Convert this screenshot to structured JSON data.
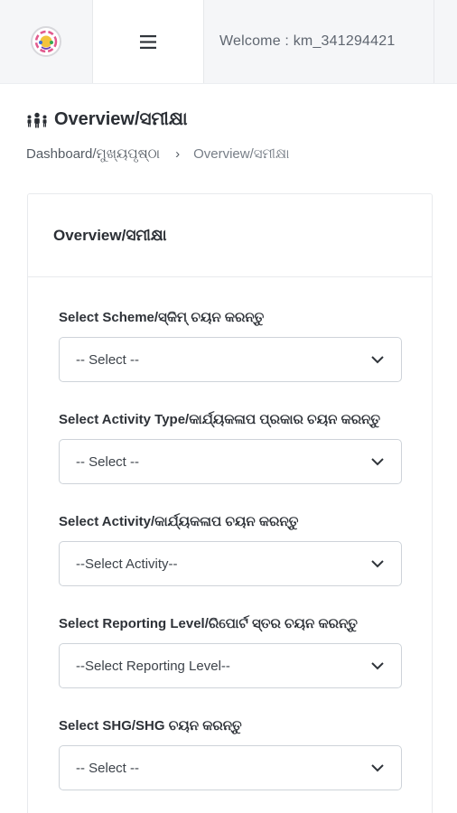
{
  "header": {
    "welcome_text": "Welcome : km_341294421"
  },
  "page": {
    "title": "Overview/ସମୀକ୍ଷା"
  },
  "breadcrumb": {
    "home": "Dashboard/ମୁଖ୍ୟପୃଷ୍ଠା",
    "separator": "›",
    "current": "Overview/ସମୀକ୍ଷା"
  },
  "card": {
    "title": "Overview/ସମୀକ୍ଷା"
  },
  "form": {
    "scheme": {
      "label": "Select Scheme/ସ୍କିମ୍ ଚୟନ କରନ୍ତୁ",
      "value": "-- Select --"
    },
    "activity_type": {
      "label": "Select Activity Type/କାର୍ଯ୍ୟକଳାପ ପ୍ରକାର ଚୟନ କରନ୍ତୁ",
      "value": "-- Select --"
    },
    "activity": {
      "label": "Select Activity/କାର୍ଯ୍ୟକଳାପ ଚୟନ କରନ୍ତୁ",
      "value": "--Select Activity--"
    },
    "reporting_level": {
      "label": "Select Reporting Level/ରିପୋର୍ଟ ସ୍ତର ଚୟନ କରନ୍ତୁ",
      "value": "--Select Reporting Level--"
    },
    "shg": {
      "label": "Select SHG/SHG ଚୟନ କରନ୍ତୁ",
      "value": "-- Select --"
    }
  },
  "icons": {
    "logo": "app-logo-icon",
    "menu": "hamburger-menu-icon",
    "title": "people-group-icon",
    "dropdown": "chevron-down-icon"
  },
  "colors": {
    "header_bg": "#f5f6f8",
    "border": "#e8eaed",
    "text": "#2b2f35"
  }
}
